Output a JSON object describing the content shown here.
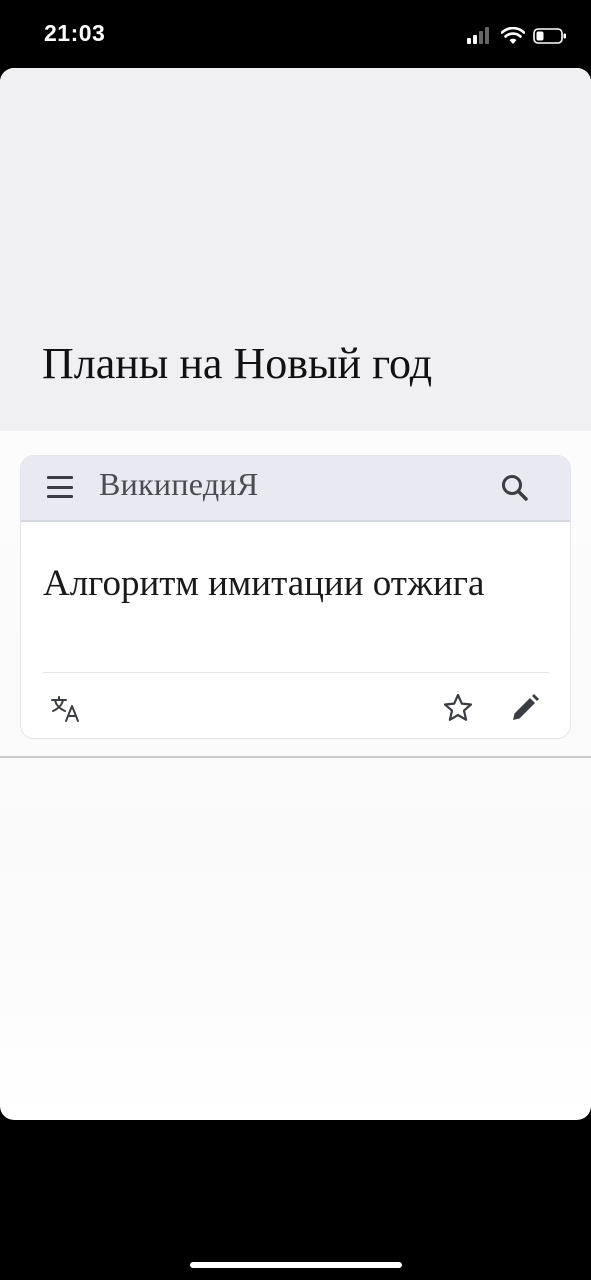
{
  "status_bar": {
    "time": "21:03",
    "icons": [
      "cellular-signal-icon",
      "wifi-icon",
      "battery-icon"
    ]
  },
  "meme": {
    "caption": "Планы на Новый год"
  },
  "wiki": {
    "logo": "ВикипедиЯ",
    "article_title": "Алгоритм имитации отжига",
    "icons": [
      "menu-icon",
      "search-icon",
      "translate-icon",
      "star-icon",
      "edit-icon"
    ]
  },
  "colors": {
    "status_bar_bg": "#000000",
    "header_bg": "#f0f0f2",
    "wiki_topbar_bg": "#e9eaf1",
    "icon_color": "#3b3d44"
  }
}
